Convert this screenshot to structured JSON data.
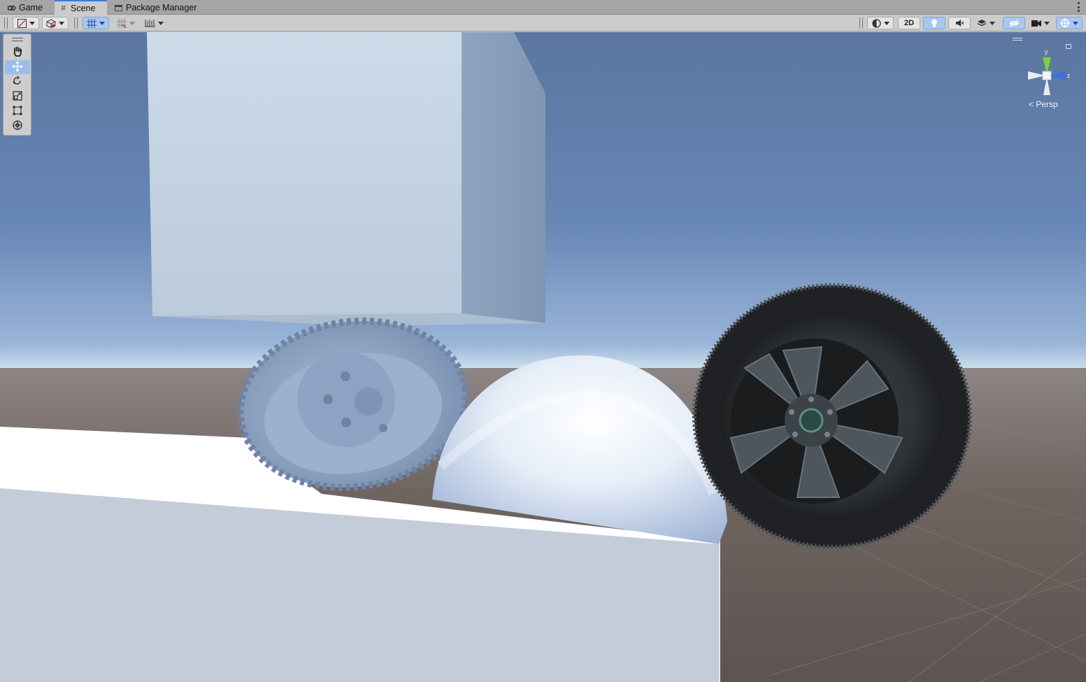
{
  "tabs": [
    {
      "label": "Game",
      "icon": "gamepad-icon",
      "active": false
    },
    {
      "label": "Scene",
      "icon": "grid-hash-icon",
      "active": true
    },
    {
      "label": "Package Manager",
      "icon": "package-icon",
      "active": false
    }
  ],
  "toolbar": {
    "mode_2d_label": "2D"
  },
  "tools": [
    "hand-tool",
    "move-tool",
    "rotate-tool",
    "scale-tool",
    "rect-tool",
    "transform-tool"
  ],
  "active_tool": "move-tool",
  "gizmo": {
    "projection_label": "Persp",
    "axis_y": "y",
    "axis_z": "z"
  },
  "colors": {
    "accent": "#3a79d8",
    "active_button": "#a9c7ef",
    "sky_top": "#5a76a0",
    "horizon": "#e9f1f5",
    "ground": "#6e6460",
    "gizmo_y": "#7fd13b",
    "gizmo_z": "#3f6fe0"
  }
}
